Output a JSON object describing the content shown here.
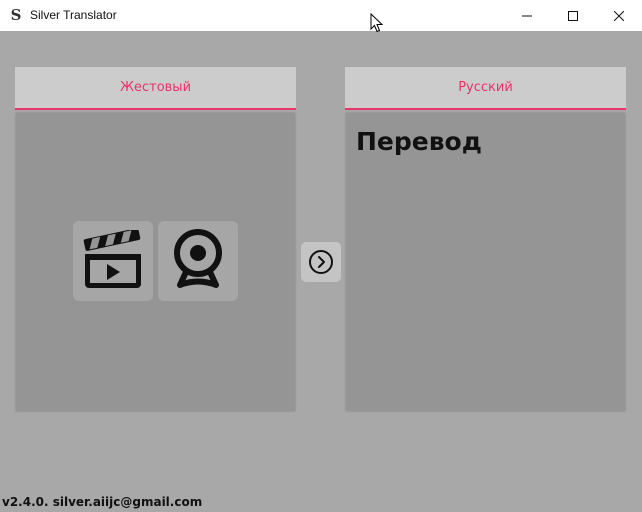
{
  "window": {
    "logo": "S",
    "title": "Silver Translator"
  },
  "source_panel": {
    "header": "Жестовый",
    "video_icon": "clapperboard-icon",
    "camera_icon": "webcam-icon"
  },
  "translate_button": {
    "icon": "chevron-right-circle-icon"
  },
  "target_panel": {
    "header": "Русский",
    "output": "Перевод"
  },
  "footer": {
    "text": "v2.4.0. silver.aiijc@gmail.com"
  },
  "colors": {
    "accent": "#e8336b",
    "background": "#a8a8a8",
    "panel_body": "#959595",
    "panel_header": "#cccccc"
  }
}
